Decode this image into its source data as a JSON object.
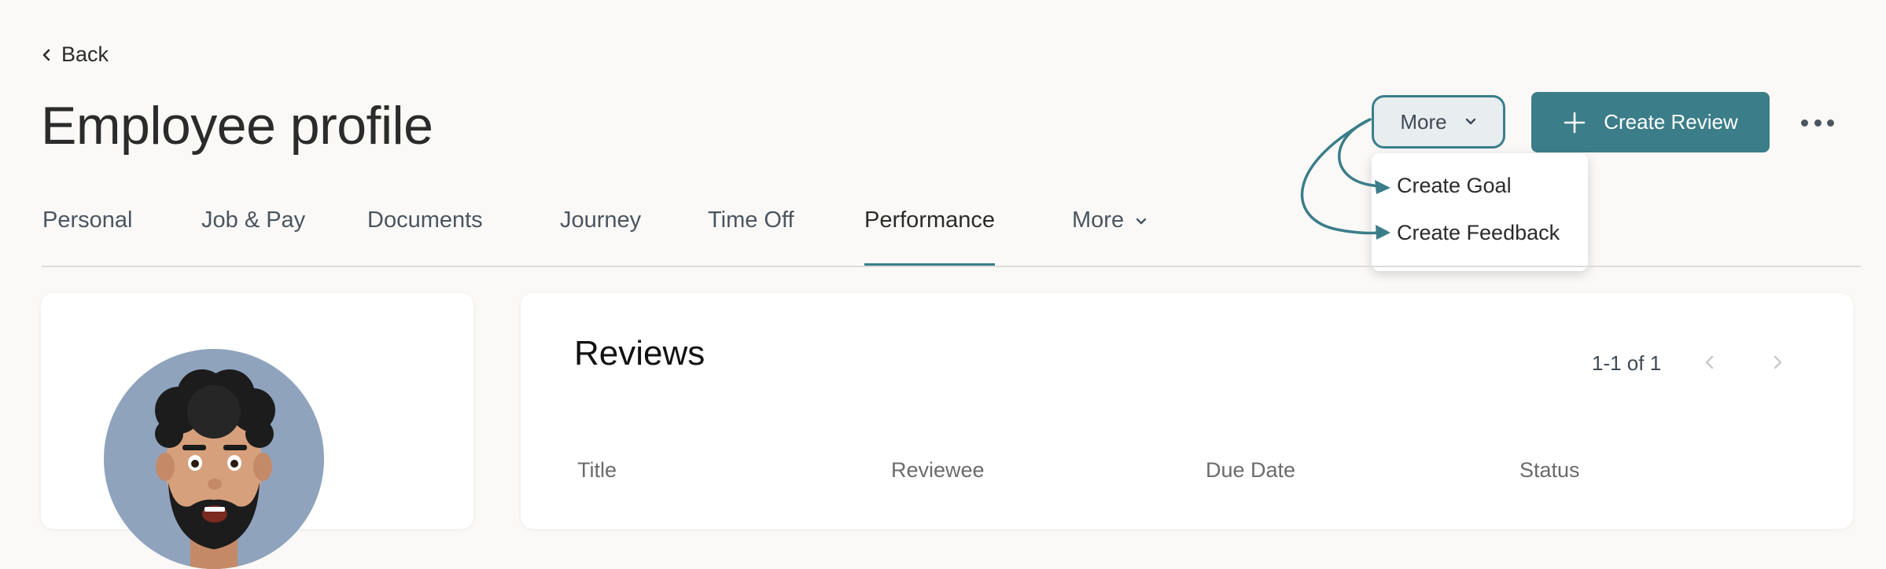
{
  "back": {
    "label": "Back"
  },
  "page": {
    "title": "Employee profile"
  },
  "header_actions": {
    "more_label": "More",
    "create_review_label": "Create Review"
  },
  "dropdown": {
    "items": [
      {
        "label": "Create Goal"
      },
      {
        "label": "Create Feedback"
      }
    ]
  },
  "tabs": [
    {
      "label": "Personal",
      "active": false
    },
    {
      "label": "Job & Pay",
      "active": false
    },
    {
      "label": "Documents",
      "active": false
    },
    {
      "label": "Journey",
      "active": false
    },
    {
      "label": "Time Off",
      "active": false
    },
    {
      "label": "Performance",
      "active": true
    },
    {
      "label": "More",
      "active": false
    }
  ],
  "reviews": {
    "title": "Reviews",
    "pagination": "1-1 of 1",
    "columns": [
      "Title",
      "Reviewee",
      "Due Date",
      "Status"
    ]
  },
  "colors": {
    "accent": "#3b7d89",
    "background": "#faf9f7",
    "avatar_bg": "#8fa3bd"
  },
  "icons": [
    "chevron-left-icon",
    "chevron-down-icon",
    "plus-icon",
    "more-horizontal-icon",
    "arrow-icon"
  ]
}
